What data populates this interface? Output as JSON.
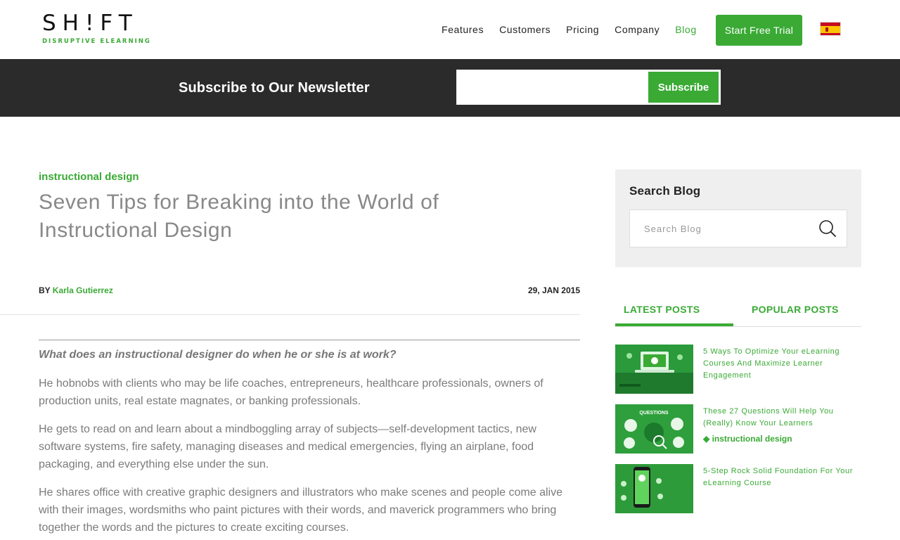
{
  "header": {
    "logo_main": "SH!FT",
    "logo_sub": "DISRUPTIVE ELEARNING",
    "nav": [
      "Features",
      "Customers",
      "Pricing",
      "Company",
      "Blog"
    ],
    "active_nav": "Blog",
    "cta_label": "Start Free Trial",
    "language_flag": "spain-flag-icon"
  },
  "newsletter": {
    "title": "Subscribe to Our Newsletter",
    "input_value": "",
    "button_label": "Subscribe"
  },
  "article": {
    "category": "instructional design",
    "title": "Seven Tips for Breaking into the World of Instructional Design",
    "by_label": "BY",
    "author": "Karla Gutierrez",
    "date": "29, JAN 2015",
    "lead": "What does an instructional designer do when he or she is at work?",
    "paragraphs": [
      "He hobnobs with clients who may be life coaches, entrepreneurs, healthcare professionals, owners of production units, real estate magnates, or banking professionals.",
      "He gets to read on and learn about a mindboggling array of subjects—self-development tactics, new software systems, fire safety, managing diseases and medical emergencies, flying an airplane, food packaging, and everything else under the sun.",
      "He shares office with creative graphic designers and illustrators who make scenes and people come alive with their images, wordsmiths who paint pictures with their words, and maverick programmers who bring together the words and the pictures to create exciting courses."
    ]
  },
  "sidebar": {
    "search_title": "Search Blog",
    "search_placeholder": "Search Blog",
    "search_icon": "search-icon",
    "tabs": [
      "LATEST POSTS",
      "POPULAR POSTS"
    ],
    "active_tab": "LATEST POSTS",
    "posts": [
      {
        "title": "5 Ways To Optimize Your eLearning Courses And Maximize Learner Engagement",
        "tag": ""
      },
      {
        "title": "These 27 Questions Will Help You (Really) Know Your Learners",
        "tag": "instructional design",
        "thumb_text": "QUESTIONS"
      },
      {
        "title": "5-Step Rock Solid Foundation For Your eLearning Course",
        "tag": ""
      }
    ]
  },
  "colors": {
    "brand_green": "#3aaa35",
    "dark_bar": "#2b2b2b",
    "sidebar_bg": "#efefef"
  }
}
